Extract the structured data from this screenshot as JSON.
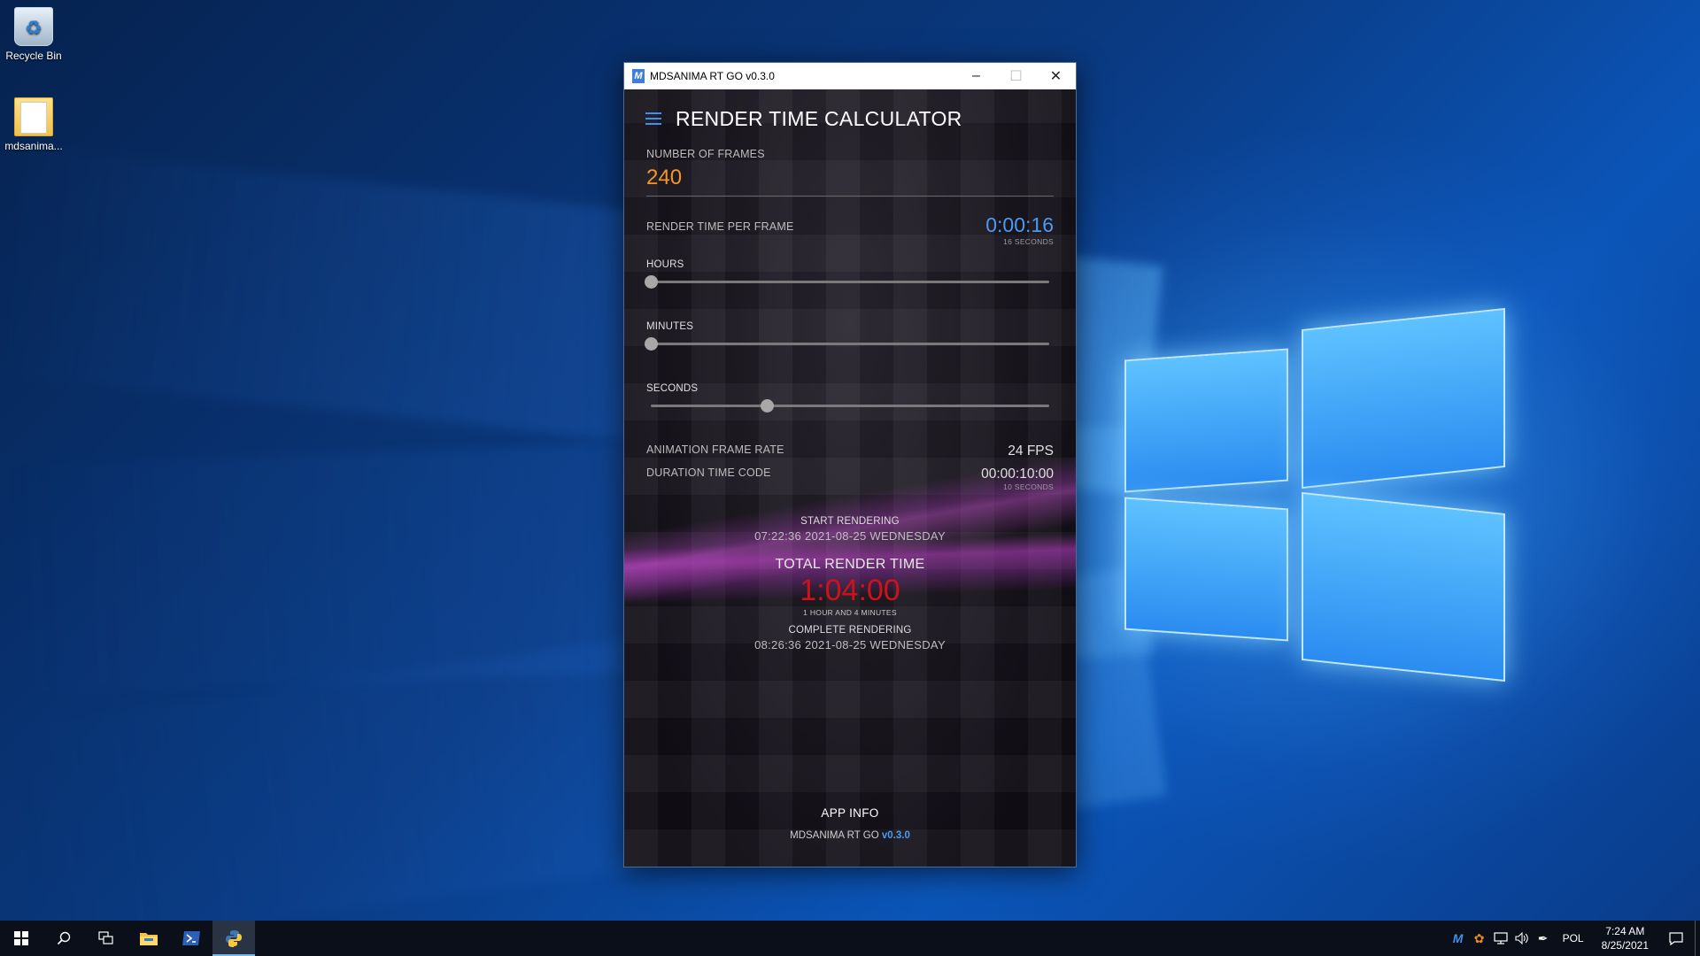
{
  "desktop": {
    "icons": [
      {
        "label": "Recycle Bin"
      },
      {
        "label": "mdsanima..."
      }
    ]
  },
  "window": {
    "title": "MDSANIMA RT GO v0.3.0",
    "logo_letter": "M",
    "controls": {
      "minimize": "–",
      "maximize": "☐",
      "close": "✕"
    }
  },
  "app": {
    "title": "RENDER TIME CALCULATOR",
    "frames": {
      "label": "NUMBER OF FRAMES",
      "value": "240"
    },
    "render_time_per_frame": {
      "label": "RENDER TIME PER FRAME",
      "value": "0:00:16",
      "caption": "16 SECONDS"
    },
    "sliders": {
      "hours": {
        "label": "HOURS",
        "value_fraction": 0.0
      },
      "minutes": {
        "label": "MINUTES",
        "value_fraction": 0.0
      },
      "seconds": {
        "label": "SECONDS",
        "value_fraction": 0.29
      }
    },
    "frame_rate": {
      "label": "ANIMATION FRAME RATE",
      "value": "24 FPS"
    },
    "duration": {
      "label": "DURATION TIME CODE",
      "value": "00:00:10:00",
      "caption": "10 SECONDS"
    },
    "start": {
      "label": "START RENDERING",
      "datetime": "07:22:36  2021-08-25  WEDNESDAY"
    },
    "total": {
      "label": "TOTAL RENDER TIME",
      "value": "1:04:00",
      "caption": "1 HOUR AND 4 MINUTES"
    },
    "complete": {
      "label": "COMPLETE RENDERING",
      "datetime": "08:26:36  2021-08-25  WEDNESDAY"
    },
    "footer": {
      "app_info": "APP INFO",
      "app_name": "MDSANIMA RT GO",
      "version": "v0.3.0"
    }
  },
  "taskbar": {
    "language": "POL",
    "time": "7:24 AM",
    "date": "8/25/2021"
  },
  "colors": {
    "accent_blue": "#4c9bf2",
    "frames_orange": "#f3962a",
    "total_red": "#d0111c"
  }
}
